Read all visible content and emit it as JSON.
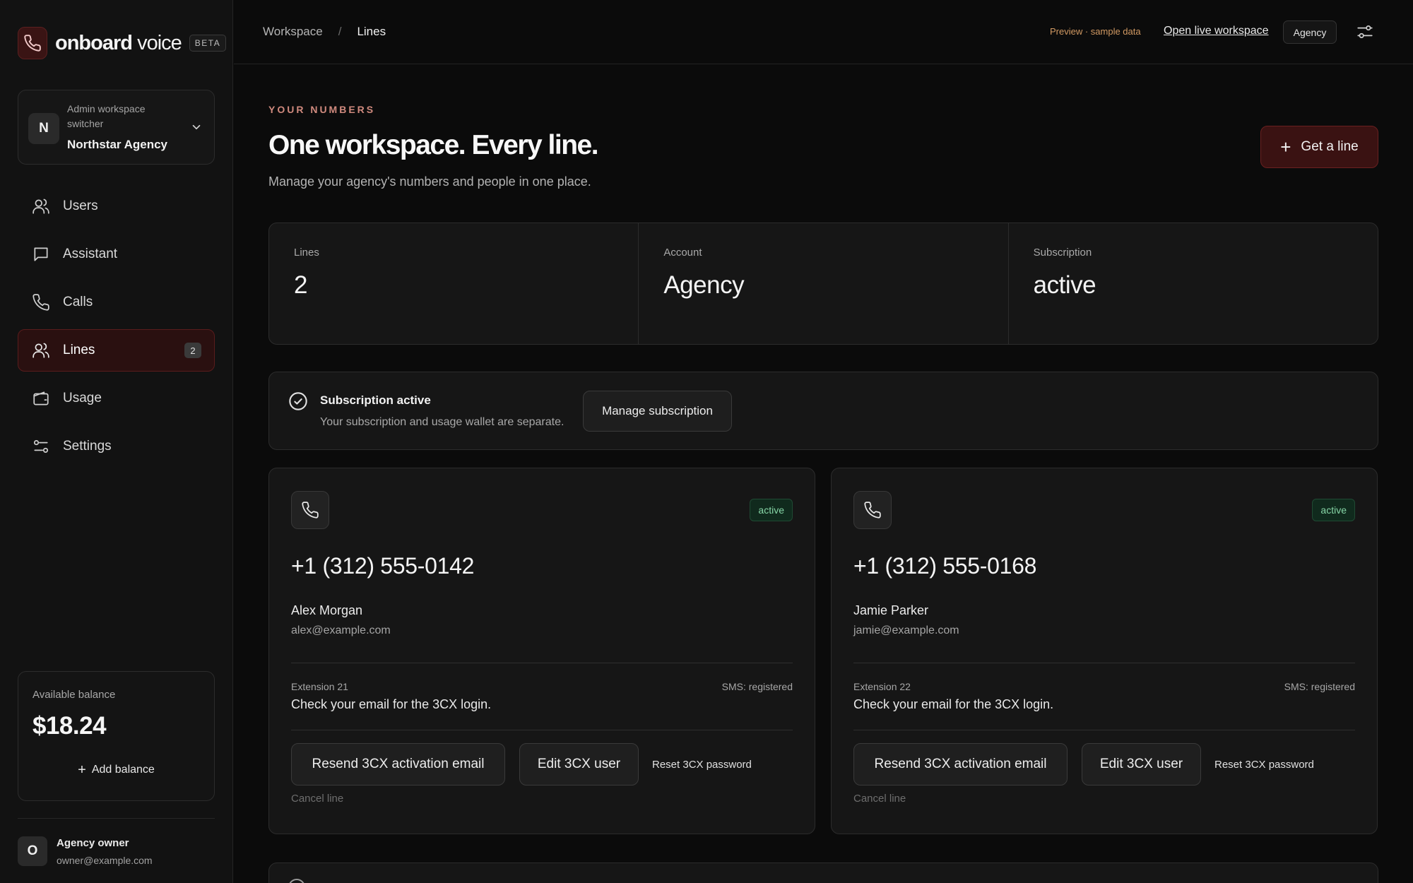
{
  "brand": {
    "name_bold": "onboard",
    "name_light": "voice",
    "badge": "BETA"
  },
  "workspace": {
    "caption": "Admin workspace switcher",
    "initial": "N",
    "name": "Northstar Agency"
  },
  "nav": [
    {
      "label": "Users",
      "icon": "users-icon",
      "active": false
    },
    {
      "label": "Assistant",
      "icon": "chat-icon",
      "active": false
    },
    {
      "label": "Calls",
      "icon": "phone-icon",
      "active": false
    },
    {
      "label": "Lines",
      "icon": "users-icon",
      "active": true,
      "badge": "2"
    },
    {
      "label": "Usage",
      "icon": "wallet-icon",
      "active": false
    },
    {
      "label": "Settings",
      "icon": "sliders-icon",
      "active": false
    }
  ],
  "balance": {
    "caption": "Available balance",
    "value": "$18.24",
    "add_label": "Add balance"
  },
  "owner": {
    "initial": "O",
    "name": "Agency owner",
    "email": "owner@example.com"
  },
  "topbar": {
    "breadcrumb": [
      "Workspace",
      "Lines"
    ],
    "separator": "/",
    "preview_note": "Preview · sample data",
    "open_live": "Open live workspace",
    "account_chip": "Agency"
  },
  "header": {
    "eyebrow": "YOUR NUMBERS",
    "title": "One workspace. Every line.",
    "subtitle": "Manage your agency's numbers and people in one place.",
    "cta": "Get a line"
  },
  "stats": [
    {
      "label": "Lines",
      "value": "2"
    },
    {
      "label": "Account",
      "value": "Agency"
    },
    {
      "label": "Subscription",
      "value": "active"
    }
  ],
  "subscription": {
    "title": "Subscription active",
    "description": "Your subscription and usage wallet are separate.",
    "button": "Manage subscription"
  },
  "lines": [
    {
      "status": "active",
      "number": "+1 (312) 555-0142",
      "name": "Alex Morgan",
      "email": "alex@example.com",
      "extension": "Extension 21",
      "sms": "SMS: registered",
      "hint": "Check your email for the 3CX login.",
      "resend": "Resend 3CX activation email",
      "edit": "Edit 3CX user",
      "reset": "Reset 3CX password",
      "cancel": "Cancel line"
    },
    {
      "status": "active",
      "number": "+1 (312) 555-0168",
      "name": "Jamie Parker",
      "email": "jamie@example.com",
      "extension": "Extension 22",
      "sms": "SMS: registered",
      "hint": "Check your email for the 3CX login.",
      "resend": "Resend 3CX activation email",
      "edit": "Edit 3CX user",
      "reset": "Reset 3CX password",
      "cancel": "Cancel line"
    }
  ],
  "colors": {
    "accent": "#5a1c1c",
    "accent_bg": "#2a1010",
    "status_active": "#86d5a6",
    "preview": "#d29a63"
  }
}
